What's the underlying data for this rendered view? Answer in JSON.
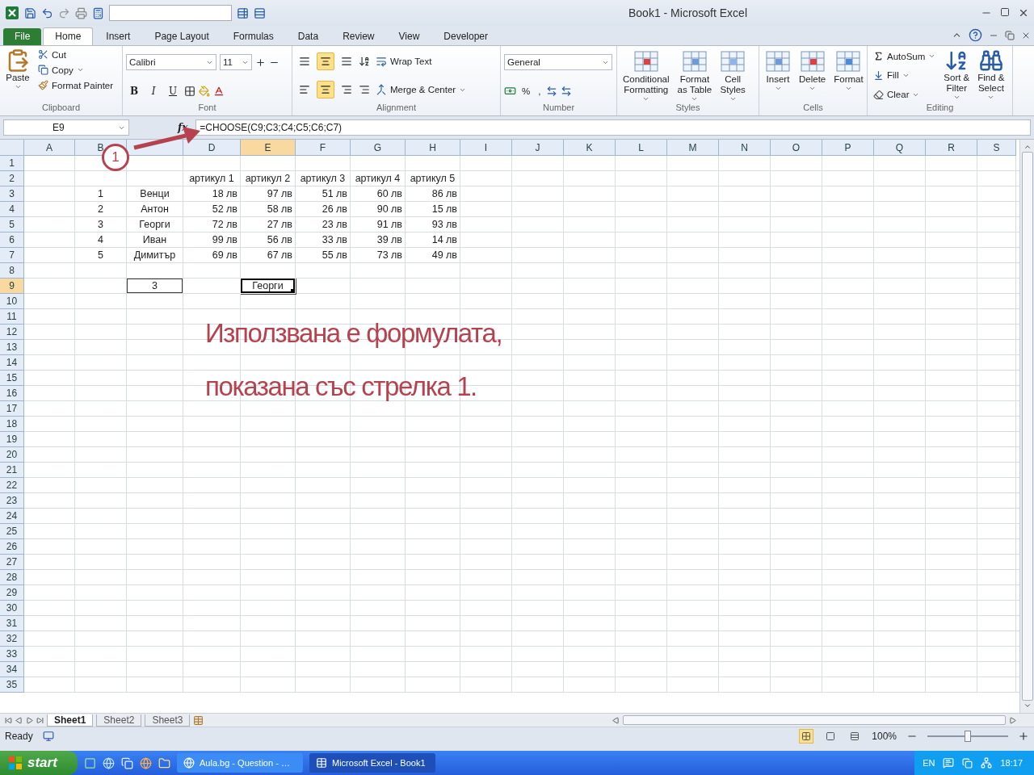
{
  "window": {
    "title": "Book1  -  Microsoft Excel"
  },
  "ribbon_tabs": [
    {
      "label": "File",
      "kind": "file",
      "selected": false
    },
    {
      "label": "Home",
      "kind": "tab",
      "selected": true
    },
    {
      "label": "Insert",
      "kind": "tab",
      "selected": false
    },
    {
      "label": "Page Layout",
      "kind": "tab",
      "selected": false
    },
    {
      "label": "Formulas",
      "kind": "tab",
      "selected": false
    },
    {
      "label": "Data",
      "kind": "tab",
      "selected": false
    },
    {
      "label": "Review",
      "kind": "tab",
      "selected": false
    },
    {
      "label": "View",
      "kind": "tab",
      "selected": false
    },
    {
      "label": "Developer",
      "kind": "tab",
      "selected": false
    }
  ],
  "clipboard": {
    "paste": "Paste",
    "cut": "Cut",
    "copy": "Copy",
    "format_painter": "Format Painter",
    "label": "Clipboard"
  },
  "font": {
    "name": "Calibri",
    "size": "11",
    "bold": "B",
    "italic": "I",
    "underline": "U",
    "label": "Font"
  },
  "alignment": {
    "vertical_align": [
      {
        "selected": false
      },
      {
        "selected": true
      },
      {
        "selected": false
      }
    ],
    "horizontal_align": [
      {
        "selected": false
      },
      {
        "selected": true
      },
      {
        "selected": false
      }
    ],
    "wrap_text": "Wrap Text",
    "merge_center": "Merge & Center",
    "label": "Alignment"
  },
  "number": {
    "format": "General",
    "percent": "%",
    "comma": ",",
    "label": "Number"
  },
  "styles": {
    "buttons": [
      {
        "lines": [
          "Conditional",
          "Formatting"
        ]
      },
      {
        "lines": [
          "Format",
          "as Table"
        ]
      },
      {
        "lines": [
          "Cell",
          "Styles"
        ]
      }
    ],
    "label": "Styles"
  },
  "cells_group": {
    "buttons": [
      {
        "label": "Insert"
      },
      {
        "label": "Delete"
      },
      {
        "label": "Format"
      }
    ],
    "label": "Cells"
  },
  "editing": {
    "autosum": "AutoSum",
    "fill": "Fill",
    "clear": "Clear",
    "buttons": [
      {
        "lines": [
          "Sort &",
          "Filter"
        ]
      },
      {
        "lines": [
          "Find &",
          "Select"
        ]
      }
    ],
    "label": "Editing"
  },
  "formula_bar": {
    "name_box": "E9",
    "function_button": "fx",
    "formula": "=CHOOSE(C9;C3;C4;C5;C6;C7)"
  },
  "columns": [
    {
      "label": "A",
      "selected": false
    },
    {
      "label": "B",
      "selected": false
    },
    {
      "selected": false
    },
    {
      "label": "D",
      "selected": false
    },
    {
      "label": "E",
      "selected": true
    },
    {
      "label": "F",
      "selected": false
    },
    {
      "label": "G",
      "selected": false
    },
    {
      "label": "H",
      "selected": false
    },
    {
      "label": "I",
      "selected": false
    },
    {
      "label": "J",
      "selected": false
    },
    {
      "label": "K",
      "selected": false
    },
    {
      "label": "L",
      "selected": false
    },
    {
      "label": "M",
      "selected": false
    },
    {
      "label": "N",
      "selected": false
    },
    {
      "label": "O",
      "selected": false
    },
    {
      "label": "P",
      "selected": false
    },
    {
      "label": "Q",
      "selected": false
    },
    {
      "label": "R",
      "selected": false
    },
    {
      "label": "S",
      "selected": false
    }
  ],
  "rows": [
    {
      "header": "1",
      "selected": false,
      "cells": []
    },
    {
      "header": "2",
      "selected": false,
      "cells": [
        {
          "kind": "empty"
        },
        {
          "kind": "empty"
        },
        {
          "kind": "empty"
        },
        {
          "text": "артикул 1",
          "kind": "text",
          "selected": false,
          "boxed": false
        },
        {
          "text": "артикул 2",
          "kind": "text",
          "selected": false,
          "boxed": false
        },
        {
          "text": "артикул 3",
          "kind": "text",
          "selected": false,
          "boxed": false
        },
        {
          "text": "артикул 4",
          "kind": "text",
          "selected": false,
          "boxed": false
        },
        {
          "text": "артикул 5",
          "kind": "text",
          "selected": false,
          "boxed": false
        }
      ]
    },
    {
      "header": "3",
      "selected": false,
      "cells": [
        {
          "kind": "empty"
        },
        {
          "text": "1",
          "kind": "text",
          "selected": false,
          "boxed": false
        },
        {
          "text": "Венци",
          "kind": "text",
          "selected": false,
          "boxed": false
        },
        {
          "text": "18 лв",
          "kind": "number",
          "selected": false,
          "boxed": false
        },
        {
          "text": "97 лв",
          "kind": "number",
          "selected": false,
          "boxed": false
        },
        {
          "text": "51 лв",
          "kind": "number",
          "selected": false,
          "boxed": false
        },
        {
          "text": "60 лв",
          "kind": "number",
          "selected": false,
          "boxed": false
        },
        {
          "text": "86 лв",
          "kind": "number",
          "selected": false,
          "boxed": false
        }
      ]
    },
    {
      "header": "4",
      "selected": false,
      "cells": [
        {
          "kind": "empty"
        },
        {
          "text": "2",
          "kind": "text",
          "selected": false,
          "boxed": false
        },
        {
          "text": "Антон",
          "kind": "text",
          "selected": false,
          "boxed": false
        },
        {
          "text": "52 лв",
          "kind": "number",
          "selected": false,
          "boxed": false
        },
        {
          "text": "58 лв",
          "kind": "number",
          "selected": false,
          "boxed": false
        },
        {
          "text": "26 лв",
          "kind": "number",
          "selected": false,
          "boxed": false
        },
        {
          "text": "90 лв",
          "kind": "number",
          "selected": false,
          "boxed": false
        },
        {
          "text": "15 лв",
          "kind": "number",
          "selected": false,
          "boxed": false
        }
      ]
    },
    {
      "header": "5",
      "selected": false,
      "cells": [
        {
          "kind": "empty"
        },
        {
          "text": "3",
          "kind": "text",
          "selected": false,
          "boxed": false
        },
        {
          "text": "Георги",
          "kind": "text",
          "selected": false,
          "boxed": false
        },
        {
          "text": "72 лв",
          "kind": "number",
          "selected": false,
          "boxed": false
        },
        {
          "text": "27 лв",
          "kind": "number",
          "selected": false,
          "boxed": false
        },
        {
          "text": "23 лв",
          "kind": "number",
          "selected": false,
          "boxed": false
        },
        {
          "text": "91 лв",
          "kind": "number",
          "selected": false,
          "boxed": false
        },
        {
          "text": "93 лв",
          "kind": "number",
          "selected": false,
          "boxed": false
        }
      ]
    },
    {
      "header": "6",
      "selected": false,
      "cells": [
        {
          "kind": "empty"
        },
        {
          "text": "4",
          "kind": "text",
          "selected": false,
          "boxed": false
        },
        {
          "text": "Иван",
          "kind": "text",
          "selected": false,
          "boxed": false
        },
        {
          "text": "99 лв",
          "kind": "number",
          "selected": false,
          "boxed": false
        },
        {
          "text": "56 лв",
          "kind": "number",
          "selected": false,
          "boxed": false
        },
        {
          "text": "33 лв",
          "kind": "number",
          "selected": false,
          "boxed": false
        },
        {
          "text": "39 лв",
          "kind": "number",
          "selected": false,
          "boxed": false
        },
        {
          "text": "14 лв",
          "kind": "number",
          "selected": false,
          "boxed": false
        }
      ]
    },
    {
      "header": "7",
      "selected": false,
      "cells": [
        {
          "kind": "empty"
        },
        {
          "text": "5",
          "kind": "text",
          "selected": false,
          "boxed": false
        },
        {
          "text": "Димитър",
          "kind": "text",
          "selected": false,
          "boxed": false
        },
        {
          "text": "69 лв",
          "kind": "number",
          "selected": false,
          "boxed": false
        },
        {
          "text": "67 лв",
          "kind": "number",
          "selected": false,
          "boxed": false
        },
        {
          "text": "55 лв",
          "kind": "number",
          "selected": false,
          "boxed": false
        },
        {
          "text": "73 лв",
          "kind": "number",
          "selected": false,
          "boxed": false
        },
        {
          "text": "49 лв",
          "kind": "number",
          "selected": false,
          "boxed": false
        }
      ]
    },
    {
      "header": "8",
      "selected": false,
      "cells": []
    },
    {
      "header": "9",
      "selected": true,
      "cells": [
        {
          "kind": "empty"
        },
        {
          "kind": "empty"
        },
        {
          "text": "3",
          "kind": "text",
          "selected": false,
          "boxed": true
        },
        {
          "kind": "empty"
        },
        {
          "text": "Георги",
          "kind": "text",
          "selected": true,
          "boxed": false
        }
      ]
    },
    {
      "header": "10",
      "selected": false,
      "cells": []
    },
    {
      "header": "11",
      "selected": false,
      "cells": []
    },
    {
      "header": "12",
      "selected": false,
      "cells": []
    },
    {
      "header": "13",
      "selected": false,
      "cells": []
    },
    {
      "header": "14",
      "selected": false,
      "cells": []
    },
    {
      "header": "15",
      "selected": false,
      "cells": []
    },
    {
      "header": "16",
      "selected": false,
      "cells": []
    },
    {
      "header": "17",
      "selected": false,
      "cells": []
    },
    {
      "header": "18",
      "selected": false,
      "cells": []
    },
    {
      "header": "19",
      "selected": false,
      "cells": []
    },
    {
      "header": "20",
      "selected": false,
      "cells": []
    },
    {
      "header": "21",
      "selected": false,
      "cells": []
    },
    {
      "header": "22",
      "selected": false,
      "cells": []
    },
    {
      "header": "23",
      "selected": false,
      "cells": []
    },
    {
      "header": "24",
      "selected": false,
      "cells": []
    },
    {
      "header": "25",
      "selected": false,
      "cells": []
    },
    {
      "header": "26",
      "selected": false,
      "cells": []
    },
    {
      "header": "27",
      "selected": false,
      "cells": []
    },
    {
      "header": "28",
      "selected": false,
      "cells": []
    },
    {
      "header": "29",
      "selected": false,
      "cells": []
    },
    {
      "header": "30",
      "selected": false,
      "cells": []
    },
    {
      "header": "31",
      "selected": false,
      "cells": []
    },
    {
      "header": "32",
      "selected": false,
      "cells": []
    },
    {
      "header": "33",
      "selected": false,
      "cells": []
    },
    {
      "header": "34",
      "selected": false,
      "cells": []
    },
    {
      "header": "35",
      "selected": false,
      "cells": []
    }
  ],
  "annotation": {
    "callout": "1",
    "lines": [
      "Използвана е формулата,",
      "показана със стрелка 1."
    ]
  },
  "sheet_tabs": [
    {
      "label": "Sheet1",
      "selected": true
    },
    {
      "label": "Sheet2",
      "selected": false
    },
    {
      "label": "Sheet3",
      "selected": false
    }
  ],
  "status_bar": {
    "status": "Ready",
    "view_buttons": [
      {
        "selected": true
      },
      {
        "selected": false
      },
      {
        "selected": false
      }
    ],
    "zoom": "100%",
    "zoom_slider": {
      "level": 0.5
    }
  },
  "taskbar": {
    "start": "start",
    "tasks": [
      {
        "label": "Aula.bg - Question - …",
        "selected": false
      },
      {
        "label": "Microsoft Excel - Book1",
        "selected": true
      }
    ],
    "language": "EN",
    "clock": "18:17"
  }
}
